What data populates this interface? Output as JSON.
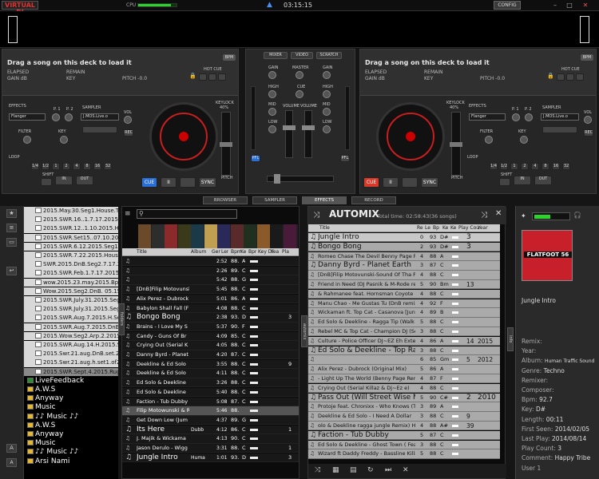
{
  "app": {
    "logo": "VIRTUAL DJ",
    "cpu_label": "CPU",
    "cpu_load": 0.85,
    "clock": "03:15:15",
    "config": "CONFIG",
    "accent": "#c81e1e"
  },
  "deck_left": {
    "message": "Drag a song on this deck to load it",
    "elapsed": "ELAPSED",
    "remain": "REMAIN",
    "gain": "GAIN dB",
    "key": "KEY",
    "pitch": "PITCH -0.0",
    "bpm": "BPM",
    "hotcue": "HOT CUE",
    "effects": "EFFECTS",
    "effect": "Flanger",
    "sampler": "SAMPLER",
    "sample": "J.MOS.Live.o",
    "filter": "FILTER",
    "keyknob": "KEY",
    "loop": "LOOP",
    "shift": "SHIFT",
    "in": "IN",
    "out": "OUT",
    "loop_sizes": [
      "1/4",
      "1/2",
      "1",
      "2",
      "4",
      "8",
      "16",
      "32"
    ],
    "cue": "CUE",
    "play": "II",
    "sync": "SYNC",
    "keylock": "KEYLOCK",
    "pct": "40%",
    "pitchlbl": "PITCH",
    "p1": "P. 1",
    "p2": "P. 2",
    "p3": "P. 3",
    "vol": "VOL",
    "rec": "REC"
  },
  "deck_right": {
    "message": "Drag a song on this deck to load it",
    "elapsed": "ELAPSED",
    "remain": "REMAIN",
    "gain": "GAIN dB",
    "key": "KEY",
    "pitch": "PITCH -0.0",
    "bpm": "BPM",
    "hotcue": "HOT CUE",
    "effects": "EFFECTS",
    "effect": "Flanger",
    "sampler": "SAMPLER",
    "sample": "J.MOS.Live.o",
    "filter": "FILTER",
    "keyknob": "KEY",
    "loop": "LOOP",
    "shift": "SHIFT",
    "in": "IN",
    "out": "OUT",
    "loop_sizes": [
      "1/4",
      "1/2",
      "1",
      "2",
      "4",
      "8",
      "16",
      "32"
    ],
    "cue": "CUE",
    "play": "II",
    "sync": "SYNC",
    "keylock": "KEYLOCK",
    "pct": "40%",
    "pitchlbl": "PITCH",
    "p1": "P. 1",
    "p2": "P. 2",
    "p3": "P. 3",
    "vol": "VOL",
    "rec": "REC"
  },
  "mixer": {
    "tabs": [
      "MIXER",
      "VIDEO",
      "SCRATCH"
    ],
    "gain": "GAIN",
    "master": "MASTER",
    "cue": "CUE",
    "high": "HIGH",
    "mid": "MID",
    "low": "LOW",
    "volume": "VOLUME",
    "pfl": "PFL"
  },
  "browser_tabs": [
    "BROWSER",
    "SAMPLER",
    "EFFECTS",
    "RECORD"
  ],
  "folders": [
    "2015.May.30.Seg1.House.This",
    "2015.SWR.16..1.7.17.2015H.h",
    "2015.SWR.12..1.10.2015.Hous",
    "2015.SWR.Set15..07.10.2015.",
    "2015.SWR.6.12.2015.Seg1.&.2",
    "2015.SWR.7.22.2015.House.in",
    "SWR.2015.DnB.Seg2.7.17.2015",
    "2015.SWR.Feb.1.7.17.2015.Ho",
    "wow.2015.23.may.2015.Bpm12",
    "Wow.2015.Seg2.DnB. 05.15.2015",
    "2015.SWR.July.31.2015.Seg1.",
    "2015.SWR.July.31.2015.Seg1.",
    "2015.SWR.Aug.7.2015.H.Set.1",
    "2015.SWR.Aug.7.2015.DnB.Se",
    "2015.Wow.Seg2.Arp.2.2015.Se",
    "2015.SWR.Aug.14.H.2015.Set",
    "2015.Swr.21.aug.DnB.set.2.of2",
    "2015.Swr.21.aug.h.set1.of2.20",
    "2015.SWR.Sept.4.2015.Rugga",
    "LiveFeedback",
    "A.W.S",
    "Anyway",
    "Music",
    "♪♪ Music ♪♪",
    "A.W.S",
    "Anyway",
    "Music",
    "♪♪ Music ♪♪",
    "Arsi Nami"
  ],
  "filelist": {
    "headers": [
      "Title",
      "Album",
      "Ger",
      "Ler",
      "Bpm",
      "Ke",
      "Bpr",
      "Key Di",
      "Yea",
      "Pla"
    ],
    "side_tab": "folders",
    "rows": [
      {
        "title": "",
        "len": "2:52",
        "bpm": "88.",
        "key": "A",
        "yr": "",
        "play": ""
      },
      {
        "title": "",
        "len": "2:26",
        "bpm": "89.",
        "key": "C",
        "yr": "",
        "play": ""
      },
      {
        "title": "",
        "len": "5:42",
        "bpm": "88.",
        "key": "G",
        "yr": "",
        "play": ""
      },
      {
        "title": "[DnB]Filip Motovunski",
        "len": "5:45",
        "bpm": "88.",
        "key": "C",
        "yr": "",
        "play": ""
      },
      {
        "title": "Alix Perez - Dubrock",
        "len": "5:01",
        "bpm": "86.",
        "key": "A",
        "yr": "",
        "play": ""
      },
      {
        "title": "Babylon Shall Fall (F",
        "len": "4:08",
        "bpm": "88.",
        "key": "C",
        "yr": "",
        "play": ""
      },
      {
        "title": "Bongo Bong",
        "len": "2:38",
        "bpm": "93.",
        "key": "D",
        "yr": "",
        "play": "3",
        "big": true
      },
      {
        "title": "Brains - I Love My S",
        "len": "5:37",
        "bpm": "90.",
        "key": "F",
        "yr": "",
        "play": ""
      },
      {
        "title": "Candy - Guns Of Br",
        "len": "4:09",
        "bpm": "85.",
        "key": "C",
        "yr": "",
        "play": ""
      },
      {
        "title": "Crying Out (Serial K",
        "len": "4:05",
        "bpm": "88.",
        "key": "C",
        "yr": "",
        "play": ""
      },
      {
        "title": "Danny Byrd - Planet",
        "len": "4:20",
        "bpm": "87.",
        "key": "C",
        "yr": "",
        "play": ""
      },
      {
        "title": "Deekline & Ed Solo",
        "len": "3:55",
        "bpm": "88.",
        "key": "C",
        "yr": "",
        "play": "9"
      },
      {
        "title": "Deekline & Ed Solo",
        "len": "4:11",
        "bpm": "88.",
        "key": "C",
        "yr": "",
        "play": ""
      },
      {
        "title": "Ed Solo & Deekline",
        "len": "3:26",
        "bpm": "88.",
        "key": "C",
        "yr": "",
        "play": ""
      },
      {
        "title": "Ed Solo & Deekline",
        "len": "5:40",
        "bpm": "88.",
        "key": "C",
        "yr": "",
        "play": ""
      },
      {
        "title": "Faction - Tub Dubby",
        "len": "5:08",
        "bpm": "87.",
        "key": "C",
        "yr": "",
        "play": ""
      },
      {
        "title": "Filip Motowunski & Rat",
        "len": "5:46",
        "bpm": "88.",
        "key": "",
        "yr": "",
        "play": ""
      },
      {
        "title": "Get Down Low (Jum",
        "len": "4:37",
        "bpm": "89.",
        "key": "G",
        "yr": "",
        "play": ""
      },
      {
        "title": "Its Here",
        "album": "Dubb",
        "len": "4:12",
        "bpm": "86.",
        "key": "C",
        "yr": "",
        "play": "1",
        "big": true
      },
      {
        "title": "J. Majik & Wickama",
        "len": "4:13",
        "bpm": "90.",
        "key": "C",
        "yr": "",
        "play": ""
      },
      {
        "title": "Jason Derulo - Wigg",
        "len": "3:31",
        "bpm": "88.",
        "key": "C",
        "yr": "",
        "play": "1"
      },
      {
        "title": "Jungle Intro",
        "album": "Huma",
        "len": "1:01",
        "bpm": "93.",
        "key": "D",
        "yr": "",
        "play": "3",
        "big": true
      }
    ]
  },
  "automix": {
    "title": "AUTOMIX",
    "total": "Total time: 02:58:43(36 songs)",
    "side_tab": "automix",
    "headers": [
      "Title",
      "Re",
      "Le",
      "Bp",
      "Ke",
      "Ke",
      "Play Cou",
      "Year"
    ],
    "rows": [
      {
        "title": "Jungle Intro",
        "le": "0",
        "bp": "93",
        "ke": "D#",
        "play": "3",
        "year": "",
        "big": true
      },
      {
        "title": "Bongo Bong",
        "le": "2",
        "bp": "93",
        "ke": "D#",
        "play": "3",
        "year": "",
        "big": true
      },
      {
        "title": "Romeo Chase The Devil Benny Page Rem",
        "le": "4",
        "bp": "88",
        "ke": "A",
        "play": "",
        "year": ""
      },
      {
        "title": "Danny Byrd - Planet Earth",
        "le": "3",
        "bp": "87",
        "ke": "C",
        "play": "",
        "year": "",
        "big": true
      },
      {
        "title": "[DnB]Filip Motovunski-Sound Of Tha Polic",
        "le": "4",
        "bp": "88",
        "ke": "C",
        "play": "",
        "year": ""
      },
      {
        "title": "Friend in Need (DJ Pasnik & M-Rode rem",
        "le": "5",
        "bp": "90",
        "ke": "Bm",
        "play": "13",
        "year": ""
      },
      {
        "title": "& Rahmanee feat. Hornsman Coyote - O",
        "le": "4",
        "bp": "88",
        "ke": "C",
        "play": "",
        "year": ""
      },
      {
        "title": "Manu Chao - Me Gustas Tu (DnB remix b",
        "le": "4",
        "bp": "92",
        "ke": "F",
        "play": "",
        "year": ""
      },
      {
        "title": "Wickaman ft. Top Cat - Casanova [Jung",
        "le": "4",
        "bp": "89",
        "ke": "B",
        "play": "",
        "year": ""
      },
      {
        "title": "Ed Solo & Deekline - Ragga Tip (Walk Sk",
        "le": "5",
        "bp": "88",
        "ke": "C",
        "play": "",
        "year": ""
      },
      {
        "title": "Rebel MC & Top Cat - Champion DJ (Seri",
        "le": "3",
        "bp": "88",
        "ke": "C",
        "play": "",
        "year": ""
      },
      {
        "title": "Culture - Police Officer DJ~EZ Eh Exte",
        "le": "4",
        "bp": "86",
        "ke": "A",
        "play": "14",
        "year": "2015"
      },
      {
        "title": "Ed Solo & Deekline - Top Rankin",
        "le": "3",
        "bp": "88",
        "ke": "C",
        "play": "",
        "year": "",
        "big": true
      },
      {
        "title": "",
        "le": "6",
        "bp": "85",
        "ke": "Gm",
        "play": "5",
        "year": "2012"
      },
      {
        "title": "Alix Perez - Dubrock (Original Mix)",
        "le": "5",
        "bp": "86",
        "ke": "A",
        "play": "",
        "year": ""
      },
      {
        "title": "- Light Up The World (Benny Page Rem",
        "le": "4",
        "bp": "87",
        "ke": "F",
        "play": "",
        "year": ""
      },
      {
        "title": "Crying Out (Serial Killaz & Dj~Ez e)",
        "le": "4",
        "bp": "88",
        "ke": "C",
        "play": "",
        "year": ""
      },
      {
        "title": "Pass Out (Will Street Wise Mix)",
        "le": "5",
        "bp": "90",
        "ke": "C#",
        "play": "2",
        "year": "2010",
        "big": true
      },
      {
        "title": "Protoje feat. Chronixx - Who Knows (Turn",
        "le": "3",
        "bp": "89",
        "ke": "A",
        "play": "",
        "year": ""
      },
      {
        "title": "Deekline & Ed Solo - I Need A Dollar",
        "le": "3",
        "bp": "88",
        "ke": "C",
        "play": "9",
        "year": ""
      },
      {
        "title": "olo & Deekline ragga jungle Remix) HD 3",
        "le": "4",
        "bp": "88",
        "ke": "A#",
        "play": "39",
        "year": ""
      },
      {
        "title": "Faction - Tub Dubby",
        "le": "5",
        "bp": "87",
        "ke": "C",
        "play": "",
        "year": "",
        "big": true
      },
      {
        "title": "Ed Solo & Deekline - Ghost Town ( Feat",
        "le": "3",
        "bp": "88",
        "ke": "C",
        "play": "",
        "year": ""
      },
      {
        "title": "Wizard ft Daddy Freddy - Bassline Killa (I",
        "le": "5",
        "bp": "88",
        "ke": "C",
        "play": "",
        "year": ""
      }
    ]
  },
  "info": {
    "cover_text": "FLATFOOT 56",
    "track": "Jungle Intro",
    "side_tab": "info",
    "fields": [
      {
        "k": "Remix:",
        "v": ""
      },
      {
        "k": "Year:",
        "v": ""
      },
      {
        "k": "Album:",
        "v": "Human Traffic Sound"
      },
      {
        "k": "Genre:",
        "v": "Techno"
      },
      {
        "k": "Remixer:",
        "v": ""
      },
      {
        "k": "Composer:",
        "v": ""
      },
      {
        "k": "Bpm:",
        "v": "92.7"
      },
      {
        "k": "Key:",
        "v": "D#"
      },
      {
        "k": "Length:",
        "v": "00:11"
      },
      {
        "k": "First Seen:",
        "v": "2014/02/05"
      },
      {
        "k": "Last Play:",
        "v": "2014/08/14"
      },
      {
        "k": "Play Count:",
        "v": "3"
      },
      {
        "k": "Comment:",
        "v": "Happy Tribe"
      },
      {
        "k": "User 1",
        "v": ""
      }
    ]
  }
}
